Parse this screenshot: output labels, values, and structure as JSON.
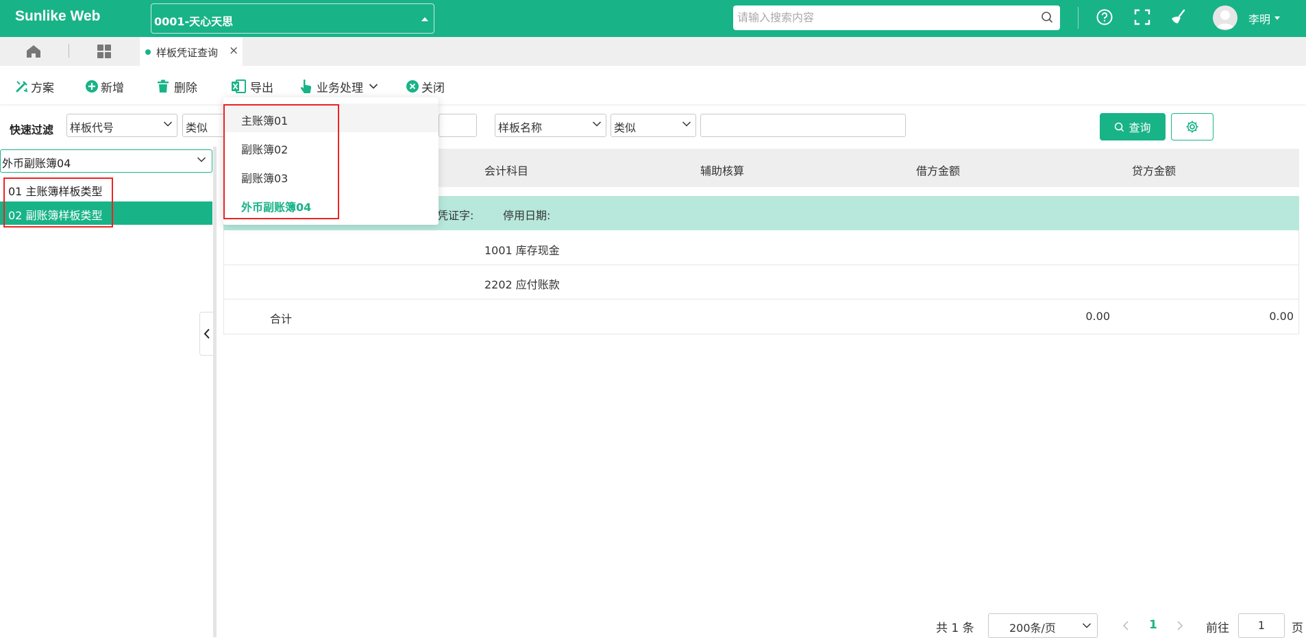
{
  "app": {
    "brand": "Sunlike Web",
    "company": "0001-天心天思",
    "search_placeholder": "请输入搜索内容",
    "user_name": "李明",
    "accent_color": "#19b388"
  },
  "tabs": [
    {
      "label": "样板凭证查询"
    }
  ],
  "toolbar": {
    "scheme": "方案",
    "add": "新增",
    "delete": "删除",
    "export": "导出",
    "business": "业务处理",
    "close": "关闭"
  },
  "filter": {
    "label": "快速过滤",
    "field1": "样板代号",
    "op1": "类似",
    "field2": "样板名称",
    "op2": "类似",
    "value2": "",
    "query_button": "查询"
  },
  "left_panel": {
    "ledger_select": "外币副账簿04",
    "tree": [
      {
        "label": "01 主账簿样板类型"
      },
      {
        "label": "02 副账簿样板类型"
      }
    ]
  },
  "ledger_dropdown": {
    "options": [
      "主账簿01",
      "副账簿02",
      "副账簿03",
      "外币副账簿04"
    ]
  },
  "table": {
    "headers": {
      "account": "会计科目",
      "aux": "辅助核算",
      "debit": "借方金额",
      "credit": "贷方金额"
    },
    "group": {
      "voucher_word_label": "凭证字:",
      "disable_date_label": "停用日期:"
    },
    "rows": [
      {
        "account": "1001 库存现金"
      },
      {
        "account": "2202 应付账款"
      }
    ],
    "total": {
      "label": "合计",
      "debit": "0.00",
      "credit": "0.00"
    }
  },
  "pager": {
    "total_text": "共 1 条",
    "page_size": "200条/页",
    "current_page": "1",
    "goto_label": "前往",
    "goto_value": "1",
    "page_suffix": "页"
  }
}
